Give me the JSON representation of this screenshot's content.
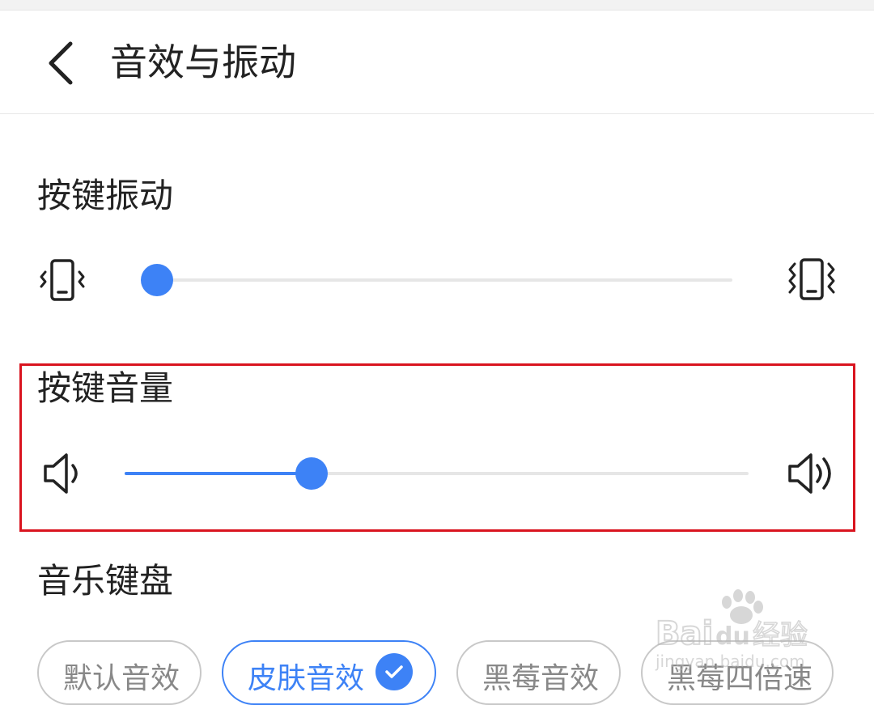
{
  "header": {
    "title": "音效与振动"
  },
  "vibration": {
    "title": "按键振动",
    "value": 0,
    "icons": [
      "vibrate-low-icon",
      "vibrate-high-icon"
    ]
  },
  "volume": {
    "title": "按键音量",
    "value": 0.3,
    "icons": [
      "volume-low-icon",
      "volume-high-icon"
    ]
  },
  "music_keyboard": {
    "title": "音乐键盘",
    "options": [
      {
        "label": "默认音效",
        "selected": false
      },
      {
        "label": "皮肤音效",
        "selected": true
      },
      {
        "label": "黑莓音效",
        "selected": false
      },
      {
        "label": "黑莓四倍速",
        "selected": false
      }
    ]
  },
  "watermark": {
    "brand": "Bai",
    "brand_suffix": "du",
    "product": "经验",
    "url": "jingyan.baidu.com"
  },
  "colors": {
    "accent": "#3d82f6",
    "highlight_border": "#d9141f"
  }
}
